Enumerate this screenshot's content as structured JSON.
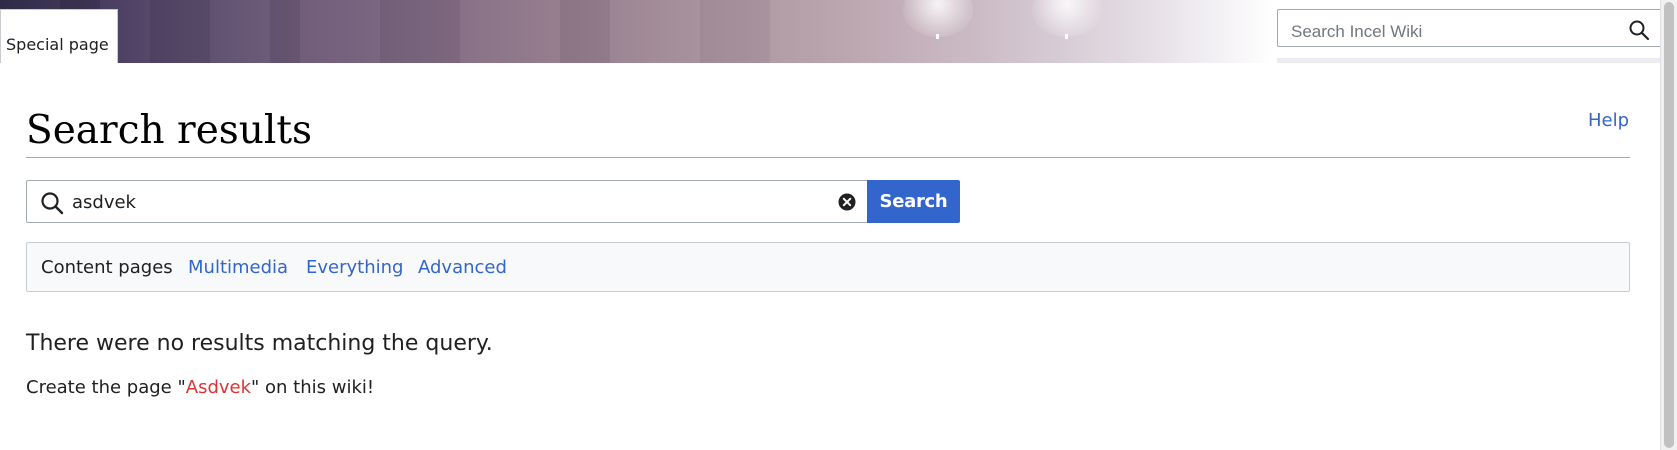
{
  "header": {
    "special_tab_label": "Special page",
    "search_placeholder": "Search Incel Wiki"
  },
  "main": {
    "title": "Search results",
    "help_link": "Help",
    "search": {
      "value": "asdvek",
      "button_label": "Search"
    },
    "filters": [
      {
        "label": "Content pages",
        "active": true
      },
      {
        "label": "Multimedia",
        "active": false
      },
      {
        "label": "Everything",
        "active": false
      },
      {
        "label": "Advanced",
        "active": false
      }
    ],
    "no_results_message": "There were no results matching the query.",
    "create_page": {
      "prefix": "Create the page \"",
      "page_name": "Asdvek",
      "suffix": "\" on this wiki!"
    }
  },
  "colors": {
    "link": "#3366cc",
    "redlink": "#d33333",
    "button_bg": "#3366cc",
    "text": "#202122",
    "filter_bg": "#f8f9fa"
  },
  "icons": {
    "header_search": "search-icon",
    "main_search": "search-icon",
    "clear": "clear-icon"
  }
}
